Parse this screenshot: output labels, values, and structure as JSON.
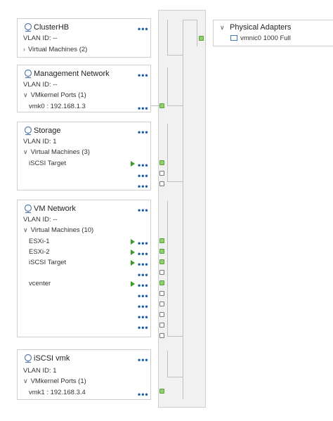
{
  "port_groups": {
    "clusterhb": {
      "name": "ClusterHB",
      "vlan": "VLAN ID: --",
      "section": "Virtual Machines (2)"
    },
    "mgmt": {
      "name": "Management Network",
      "vlan": "VLAN ID: --",
      "section": "VMkernel Ports (1)",
      "items": [
        {
          "label": "vmk0 : 192.168.1.3"
        }
      ]
    },
    "storage": {
      "name": "Storage",
      "vlan": "VLAN ID: 1",
      "section": "Virtual Machines (3)",
      "items": [
        {
          "label": "iSCSI Target"
        }
      ]
    },
    "vmnet": {
      "name": "VM Network",
      "vlan": "VLAN ID: --",
      "section": "Virtual Machines (10)",
      "items": [
        {
          "label": "ESXi-1"
        },
        {
          "label": "ESXi-2"
        },
        {
          "label": "iSCSI Target"
        },
        {
          "label": "vcenter"
        }
      ]
    },
    "iscsivmk": {
      "name": "iSCSI vmk",
      "vlan": "VLAN ID: 1",
      "section": "VMkernel Ports (1)",
      "items": [
        {
          "label": "vmk1 : 192.168.3.4"
        }
      ]
    }
  },
  "physical_adapters": {
    "title": "Physical Adapters",
    "adapter": "vmnic0 1000 Full"
  },
  "more_label": "•••",
  "colors": {
    "port_active": "#8fd16b",
    "play": "#3c9a27",
    "link": "#1b5ea8"
  },
  "icons": {
    "portgroup": "network-globe-icon",
    "nic": "nic-card-icon"
  }
}
